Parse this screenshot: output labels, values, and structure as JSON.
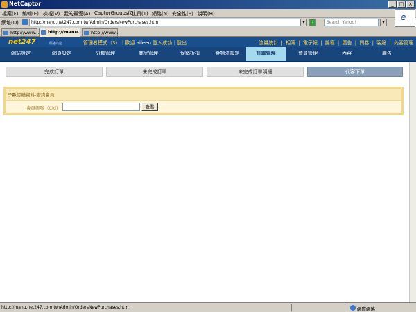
{
  "window": {
    "title": "NetCaptor"
  },
  "menu": [
    "檔案(F)",
    "編輯(E)",
    "檢視(V)",
    "我的最愛(A)",
    "CaptorGroups(G)",
    "工具(T)",
    "網路(N)",
    "安全性(S)",
    "說明(H)"
  ],
  "address": {
    "label": "網址(D)",
    "url": "http://manu.net247.com.tw/Admin/OrdersNewPurchases.htm",
    "search_placeholder": "Search Yahoo!"
  },
  "browser_tabs": [
    {
      "label": "http://www..."
    },
    {
      "label": "http://manu..."
    },
    {
      "label": "http://www..."
    }
  ],
  "header": {
    "logo": "net247",
    "logo_tag": "網路商店",
    "admin_prefix": "管理者模式（3）｜歡迎",
    "admin_user": "aileen",
    "admin_suffix": "登入成功｜登出",
    "toplinks": [
      "流量統計",
      "|",
      "相簿",
      "|",
      "電子報",
      "|",
      "論壇",
      "|",
      "廣告",
      "|",
      "問卷",
      "|",
      "客服",
      "|",
      "內容管理"
    ]
  },
  "nav": [
    {
      "label": "網站設定"
    },
    {
      "label": "網頁設定"
    },
    {
      "label": "分類管理"
    },
    {
      "label": "商品管理"
    },
    {
      "label": "促銷折扣"
    },
    {
      "label": "金物流設定"
    },
    {
      "label": "訂單管理",
      "active": true
    },
    {
      "label": "會員管理"
    },
    {
      "label": "內容"
    },
    {
      "label": "廣告"
    }
  ],
  "subtabs": [
    {
      "label": "完成訂單"
    },
    {
      "label": "未完成訂單"
    },
    {
      "label": "未完成訂單明細"
    },
    {
      "label": "代客下單",
      "active": true
    }
  ],
  "form": {
    "title": "子數訂購資料-查詢會員",
    "field_label": "會員帳號（Cid）",
    "member_value": "",
    "submit_label": "查看"
  },
  "status": {
    "url": "http://manu.net247.com.tw/Admin/OrdersNewPurchases.htm",
    "zone": "網際網路"
  },
  "colors": {
    "nav_bg": "#17457c",
    "nav_active": "#a5d9ee",
    "panel_border": "#f3d784",
    "panel_bg": "#fae9b8"
  }
}
